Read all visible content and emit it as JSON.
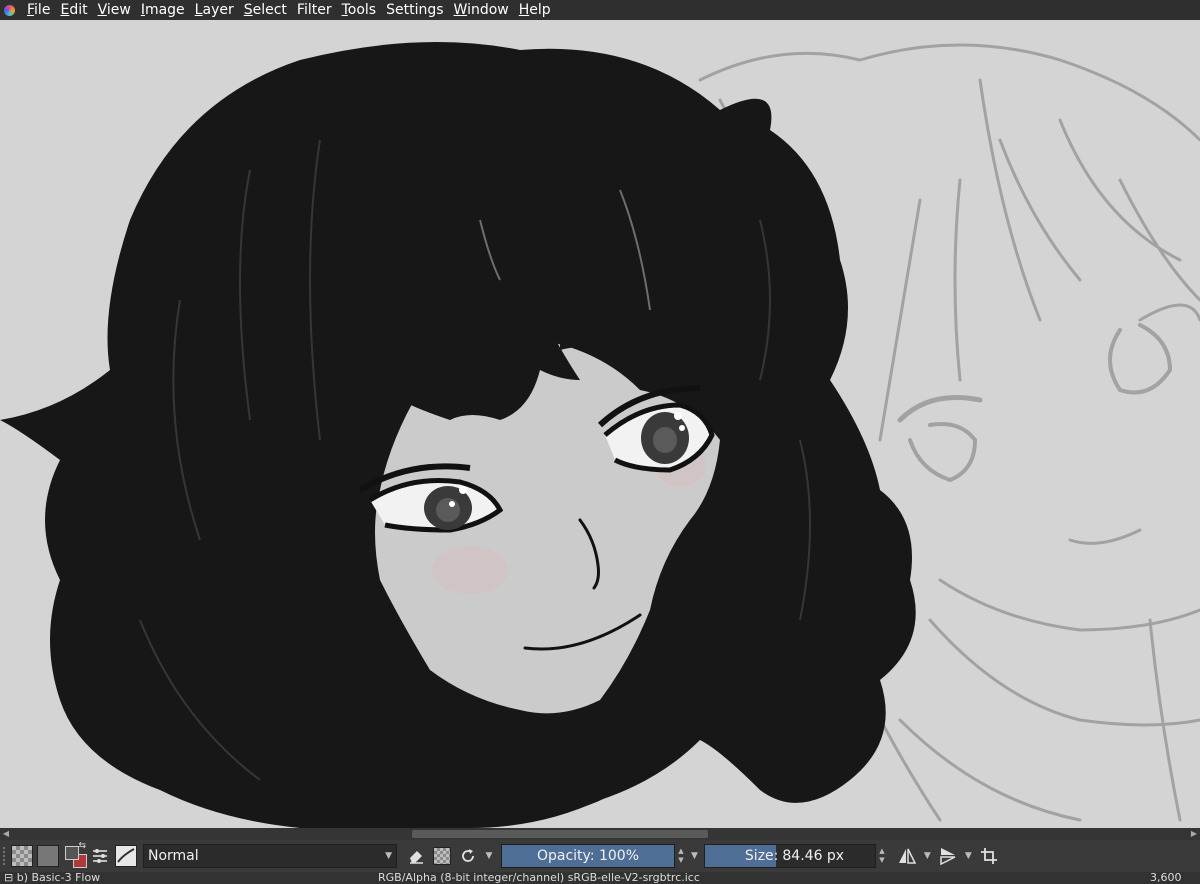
{
  "menubar": {
    "items": [
      {
        "label": "File",
        "accel": "F",
        "rest": "ile"
      },
      {
        "label": "Edit",
        "accel": "E",
        "rest": "dit"
      },
      {
        "label": "View",
        "accel": "V",
        "rest": "iew"
      },
      {
        "label": "Image",
        "accel": "I",
        "rest": "mage"
      },
      {
        "label": "Layer",
        "accel": "L",
        "rest": "ayer"
      },
      {
        "label": "Select",
        "accel": "S",
        "rest": "elect"
      },
      {
        "label": "Filter",
        "accel": "",
        "rest": "Filter"
      },
      {
        "label": "Tools",
        "accel": "T",
        "rest": "ools"
      },
      {
        "label": "Settings",
        "accel": "",
        "rest": "Settings"
      },
      {
        "label": "Window",
        "accel": "W",
        "rest": "indow"
      },
      {
        "label": "Help",
        "accel": "H",
        "rest": "elp"
      }
    ]
  },
  "canvas": {
    "background": "#d4d4d4",
    "artwork": "black-haired character illustration over grey pencil sketch"
  },
  "toolbar": {
    "blend_mode": "Normal",
    "opacity_label": "Opacity: 100%",
    "opacity_value": 100,
    "size_label": "Size:",
    "size_value": "84.46 px",
    "size_fill_fraction": 0.42,
    "icons": [
      "checker-pattern-icon",
      "grey-pattern-icon",
      "fg-bg-color-icon",
      "brush-settings-icon",
      "brush-preset-icon",
      "eraser-icon",
      "alpha-lock-icon",
      "reload-icon",
      "mirror-horizontal-icon",
      "mirror-vertical-icon",
      "wrap-around-icon"
    ]
  },
  "statusbar": {
    "left": "⊟ b) Basic-3 Flow",
    "center": "RGB/Alpha (8-bit integer/channel)  sRGB-elle-V2-srgbtrc.icc",
    "right": "3,600"
  },
  "colors": {
    "accent": "#4f6e95",
    "menubar": "#2f2f2f",
    "toolbar": "#3a3a3a"
  }
}
